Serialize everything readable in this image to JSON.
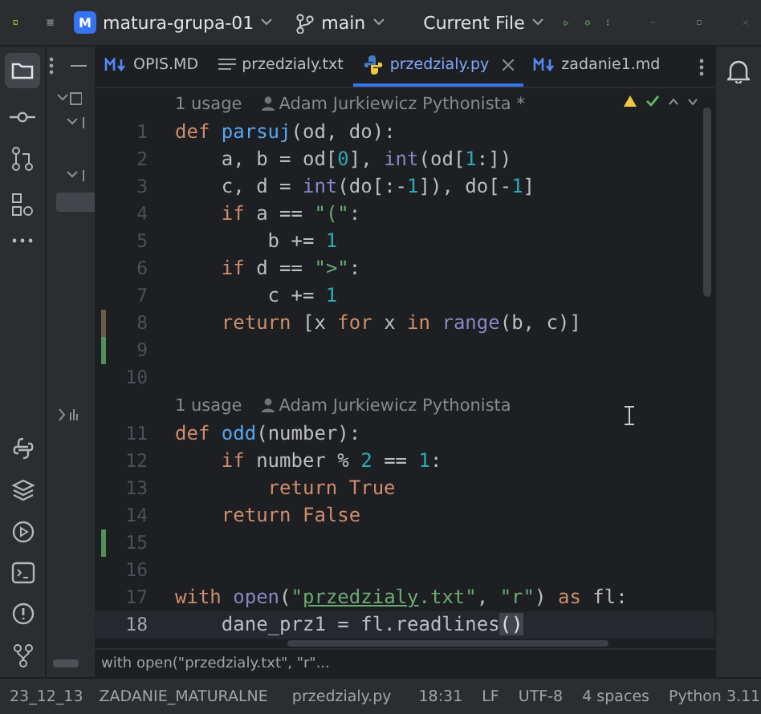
{
  "toolbar": {
    "project_badge": "M",
    "project": "matura-grupa-01",
    "branch": "main",
    "run_config": "Current File"
  },
  "tabs": [
    {
      "label": "OPIS.MD",
      "kind": "markdown",
      "selected": false
    },
    {
      "label": "przedzialy.txt",
      "kind": "text",
      "selected": false
    },
    {
      "label": "przedzialy.py",
      "kind": "python",
      "selected": true
    },
    {
      "label": "zadanie1.md",
      "kind": "markdown",
      "selected": false
    }
  ],
  "editor": {
    "blocks": [
      {
        "kind": "hint",
        "usages": "1 usage",
        "author": "Adam Jurkiewicz Pythonista *"
      },
      {
        "kind": "line",
        "number": "1",
        "current": false,
        "modified": false,
        "added": false,
        "tokens": [
          {
            "t": "def ",
            "kind": "keyword"
          },
          {
            "t": "parsuj",
            "kind": "function"
          },
          {
            "t": "(od, do):",
            "kind": "plain"
          }
        ]
      },
      {
        "kind": "line",
        "number": "2",
        "current": false,
        "modified": false,
        "added": false,
        "tokens": [
          {
            "t": "    a, b = od[",
            "kind": "plain"
          },
          {
            "t": "0",
            "kind": "number"
          },
          {
            "t": "], ",
            "kind": "plain"
          },
          {
            "t": "int",
            "kind": "builtin"
          },
          {
            "t": "(od[",
            "kind": "plain"
          },
          {
            "t": "1",
            "kind": "number"
          },
          {
            "t": ":])",
            "kind": "plain"
          }
        ]
      },
      {
        "kind": "line",
        "number": "3",
        "current": false,
        "modified": false,
        "added": false,
        "tokens": [
          {
            "t": "    c, d = ",
            "kind": "plain"
          },
          {
            "t": "int",
            "kind": "builtin"
          },
          {
            "t": "(do[:-",
            "kind": "plain"
          },
          {
            "t": "1",
            "kind": "number"
          },
          {
            "t": "]), do[-",
            "kind": "plain"
          },
          {
            "t": "1",
            "kind": "number"
          },
          {
            "t": "]",
            "kind": "plain"
          }
        ]
      },
      {
        "kind": "line",
        "number": "4",
        "current": false,
        "modified": false,
        "added": false,
        "tokens": [
          {
            "t": "    if",
            "kind": "keyword"
          },
          {
            "t": " a == ",
            "kind": "plain"
          },
          {
            "t": "\"(\"",
            "kind": "string"
          },
          {
            "t": ":",
            "kind": "plain"
          }
        ]
      },
      {
        "kind": "line",
        "number": "5",
        "current": false,
        "modified": false,
        "added": false,
        "tokens": [
          {
            "t": "        b += ",
            "kind": "plain"
          },
          {
            "t": "1",
            "kind": "number"
          }
        ]
      },
      {
        "kind": "line",
        "number": "6",
        "current": false,
        "modified": false,
        "added": false,
        "tokens": [
          {
            "t": "    if",
            "kind": "keyword"
          },
          {
            "t": " d == ",
            "kind": "plain"
          },
          {
            "t": "\">\"",
            "kind": "string"
          },
          {
            "t": ":",
            "kind": "plain"
          }
        ]
      },
      {
        "kind": "line",
        "number": "7",
        "current": false,
        "modified": false,
        "added": false,
        "tokens": [
          {
            "t": "        c += ",
            "kind": "plain"
          },
          {
            "t": "1",
            "kind": "number"
          }
        ]
      },
      {
        "kind": "line",
        "number": "8",
        "current": false,
        "modified": true,
        "added": false,
        "tokens": [
          {
            "t": "    return",
            "kind": "keyword"
          },
          {
            "t": " [x ",
            "kind": "plain"
          },
          {
            "t": "for",
            "kind": "keyword"
          },
          {
            "t": " x ",
            "kind": "plain"
          },
          {
            "t": "in ",
            "kind": "keyword"
          },
          {
            "t": "range",
            "kind": "builtin"
          },
          {
            "t": "(b, c)]",
            "kind": "plain"
          }
        ]
      },
      {
        "kind": "line",
        "number": "9",
        "current": false,
        "modified": false,
        "added": true
      },
      {
        "kind": "line",
        "number": "10",
        "current": false,
        "modified": false,
        "added": false
      },
      {
        "kind": "hint",
        "usages": "1 usage",
        "author": "Adam Jurkiewicz Pythonista"
      },
      {
        "kind": "line",
        "number": "11",
        "current": false,
        "modified": false,
        "added": false,
        "tokens": [
          {
            "t": "def ",
            "kind": "keyword"
          },
          {
            "t": "odd",
            "kind": "function"
          },
          {
            "t": "(number):",
            "kind": "plain"
          }
        ]
      },
      {
        "kind": "line",
        "number": "12",
        "current": false,
        "modified": false,
        "added": false,
        "tokens": [
          {
            "t": "    if",
            "kind": "keyword"
          },
          {
            "t": " number % ",
            "kind": "plain"
          },
          {
            "t": "2",
            "kind": "number"
          },
          {
            "t": " == ",
            "kind": "plain"
          },
          {
            "t": "1",
            "kind": "number"
          },
          {
            "t": ":",
            "kind": "plain"
          }
        ]
      },
      {
        "kind": "line",
        "number": "13",
        "current": false,
        "modified": false,
        "added": false,
        "tokens": [
          {
            "t": "        return True",
            "kind": "keyword"
          }
        ]
      },
      {
        "kind": "line",
        "number": "14",
        "current": false,
        "modified": false,
        "added": false,
        "tokens": [
          {
            "t": "    return False",
            "kind": "keyword"
          }
        ]
      },
      {
        "kind": "line",
        "number": "15",
        "current": false,
        "modified": false,
        "added": true
      },
      {
        "kind": "line",
        "number": "16",
        "current": false,
        "modified": false,
        "added": false
      },
      {
        "kind": "line",
        "number": "17",
        "current": false,
        "modified": false,
        "added": false,
        "tokens": [
          {
            "t": "with ",
            "kind": "keyword"
          },
          {
            "t": "open",
            "kind": "builtin"
          },
          {
            "t": "(",
            "kind": "plain"
          },
          {
            "t": "\"",
            "kind": "string"
          },
          {
            "t": "przedzialy",
            "kind": "link"
          },
          {
            "t": ".txt\"",
            "kind": "string"
          },
          {
            "t": ", ",
            "kind": "plain"
          },
          {
            "t": "\"r\"",
            "kind": "string"
          },
          {
            "t": ") ",
            "kind": "plain"
          },
          {
            "t": "as",
            "kind": "keyword"
          },
          {
            "t": " fl:",
            "kind": "plain"
          }
        ]
      },
      {
        "kind": "line",
        "number": "18",
        "current": true,
        "modified": false,
        "added": false,
        "tokens": [
          {
            "t": "    dane_prz1 = fl.readlines",
            "kind": "plain"
          },
          {
            "t": "()",
            "kind": "brace-match"
          }
        ]
      }
    ]
  },
  "sticky_line": "with open(\"przedzialy.txt\", \"r\"...",
  "status_bar": {
    "breadcrumbs": [
      {
        "label": "23_12_13",
        "kind": "folder"
      },
      {
        "label": "ZADANIE_MATURALNE",
        "kind": "folder"
      },
      {
        "label": "przedzialy.py",
        "kind": "python"
      }
    ],
    "items": [
      "18:31",
      "LF",
      "UTF-8",
      "4 spaces",
      "Python 3.11"
    ]
  }
}
